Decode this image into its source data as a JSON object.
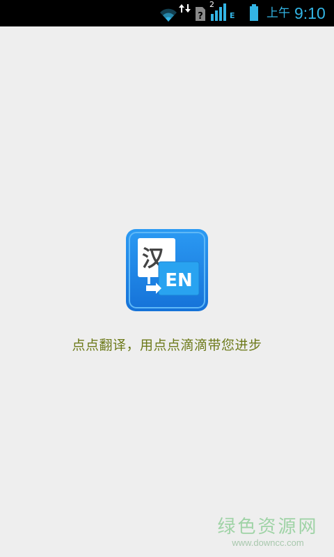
{
  "status_bar": {
    "sim_slot": "2",
    "network_type": "E",
    "ampm": "上午",
    "time": "9:10",
    "accent_color": "#33b5e5"
  },
  "splash": {
    "logo": {
      "source_char": "汉",
      "target_text": "EN",
      "colors": {
        "frame": "#1e88e5",
        "back_card": "#ffffff",
        "front_card": "#29a3f0"
      }
    },
    "slogan": "点点翻译，用点点滴滴带您进步",
    "slogan_color": "#6d7a1a"
  },
  "watermark": {
    "name": "绿色资源网",
    "url": "www.downcc.com"
  }
}
